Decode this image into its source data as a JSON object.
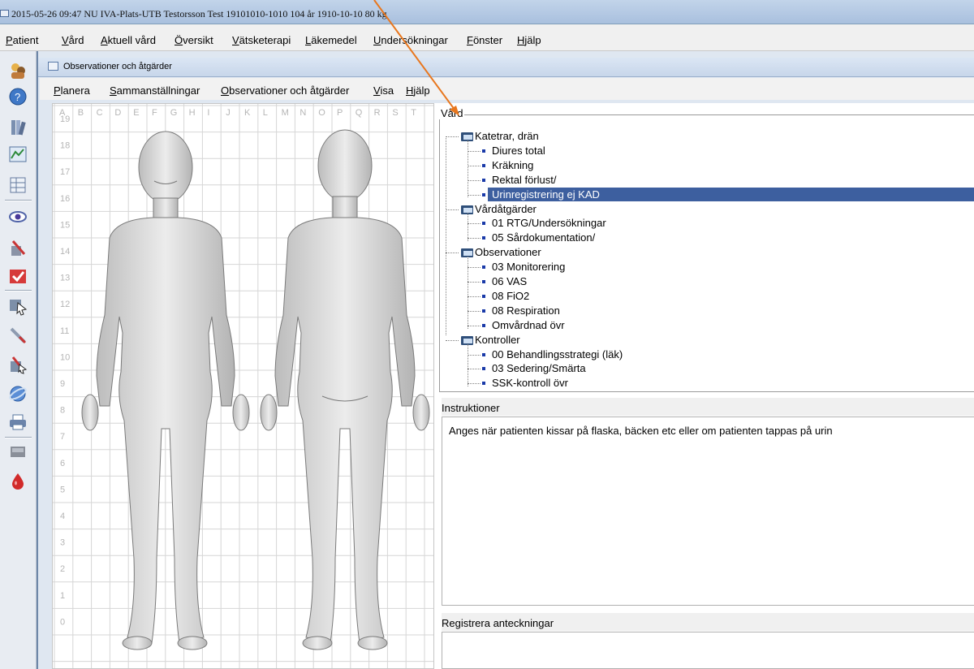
{
  "titlebar": {
    "text": "2015-05-26 09:47  NU IVA-Plats-UTB  Testorsson Test  19101010-1010  104 år 1910-10-10  80 kg"
  },
  "menubar": {
    "items": [
      "Patient",
      "Vård",
      "Aktuell vård",
      "Översikt",
      "Vätsketerapi",
      "Läkemedel",
      "Undersökningar",
      "Fönster",
      "Hjälp"
    ]
  },
  "toolbar": {
    "icons": [
      "persons-icon",
      "help-icon",
      "books-icon",
      "chart-icon",
      "spreadsheet-icon",
      "eye-icon",
      "tools-icon",
      "checkbox-icon",
      "pointer-icon",
      "syringe-icon",
      "tools-pointer-icon",
      "globe-icon",
      "printer-icon",
      "device-icon",
      "blood-drop-icon"
    ]
  },
  "window": {
    "title": "Observationer och åtgärder"
  },
  "submenu": {
    "items": [
      "Planera",
      "Sammanställningar",
      "Observationer och åtgärder",
      "Visa",
      "Hjälp"
    ]
  },
  "body_chart": {
    "columns": [
      "A",
      "B",
      "C",
      "D",
      "E",
      "F",
      "G",
      "H",
      "I",
      "J",
      "K",
      "L",
      "M",
      "N",
      "O",
      "P",
      "Q",
      "R",
      "S",
      "T"
    ],
    "rows": [
      "19",
      "18",
      "17",
      "16",
      "15",
      "14",
      "13",
      "12",
      "11",
      "10",
      "9",
      "8",
      "7",
      "6",
      "5",
      "4",
      "3",
      "2",
      "1",
      "0"
    ]
  },
  "vard": {
    "legend": "Vård",
    "groups": [
      {
        "label": "Katetrar, drän",
        "items": [
          "Diures total",
          "Kräkning",
          "Rektal förlust/",
          "Urinregistrering ej KAD"
        ]
      },
      {
        "label": "Vårdåtgärder",
        "items": [
          "01 RTG/Undersökningar",
          "05 Sårdokumentation/"
        ]
      },
      {
        "label": "Observationer",
        "items": [
          "03 Monitorering",
          "06 VAS",
          "08 FiO2",
          "08 Respiration",
          "Omvårdnad övr"
        ]
      },
      {
        "label": "Kontroller",
        "items": [
          "00 Behandlingsstrategi (läk)",
          "03 Sedering/Smärta",
          "SSK-kontroll övr"
        ]
      }
    ],
    "selected": "Urinregistrering ej KAD"
  },
  "instructions": {
    "label": "Instruktioner",
    "text": "Anges när patienten kissar på flaska, bäcken etc eller om patienten tappas på urin"
  },
  "notes": {
    "label": "Registrera anteckningar",
    "value": ""
  },
  "colors": {
    "selection": "#3d5f9f",
    "arrow": "#e8771e",
    "folder": "#2f4f7a"
  }
}
